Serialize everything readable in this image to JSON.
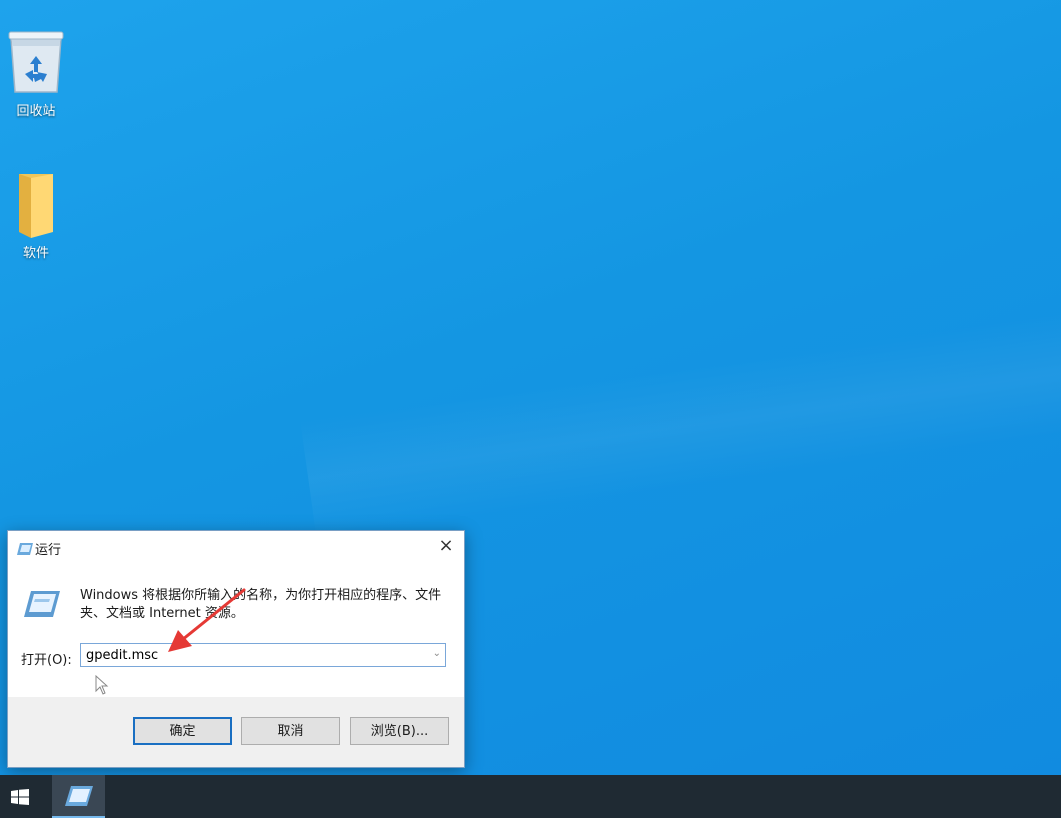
{
  "desktop": {
    "icons": [
      {
        "label": "回收站",
        "icon": "recycle-bin-icon"
      },
      {
        "label": "软件",
        "icon": "folder-icon"
      }
    ]
  },
  "run_dialog": {
    "title": "运行",
    "close_glyph": "×",
    "description": "Windows 将根据你所输入的名称，为你打开相应的程序、文件夹、文档或 Internet 资源。",
    "open_label": "打开(O):",
    "input_value": "gpedit.msc",
    "buttons": {
      "ok": "确定",
      "cancel": "取消",
      "browse": "浏览(B)..."
    }
  },
  "taskbar": {
    "start_icon": "windows-logo-icon",
    "pinned": [
      {
        "icon": "run-app-icon",
        "active": true
      }
    ]
  },
  "colors": {
    "desktop": "#1496e2",
    "taskbar": "#1f2a33",
    "annotation_arrow": "#e53935"
  }
}
